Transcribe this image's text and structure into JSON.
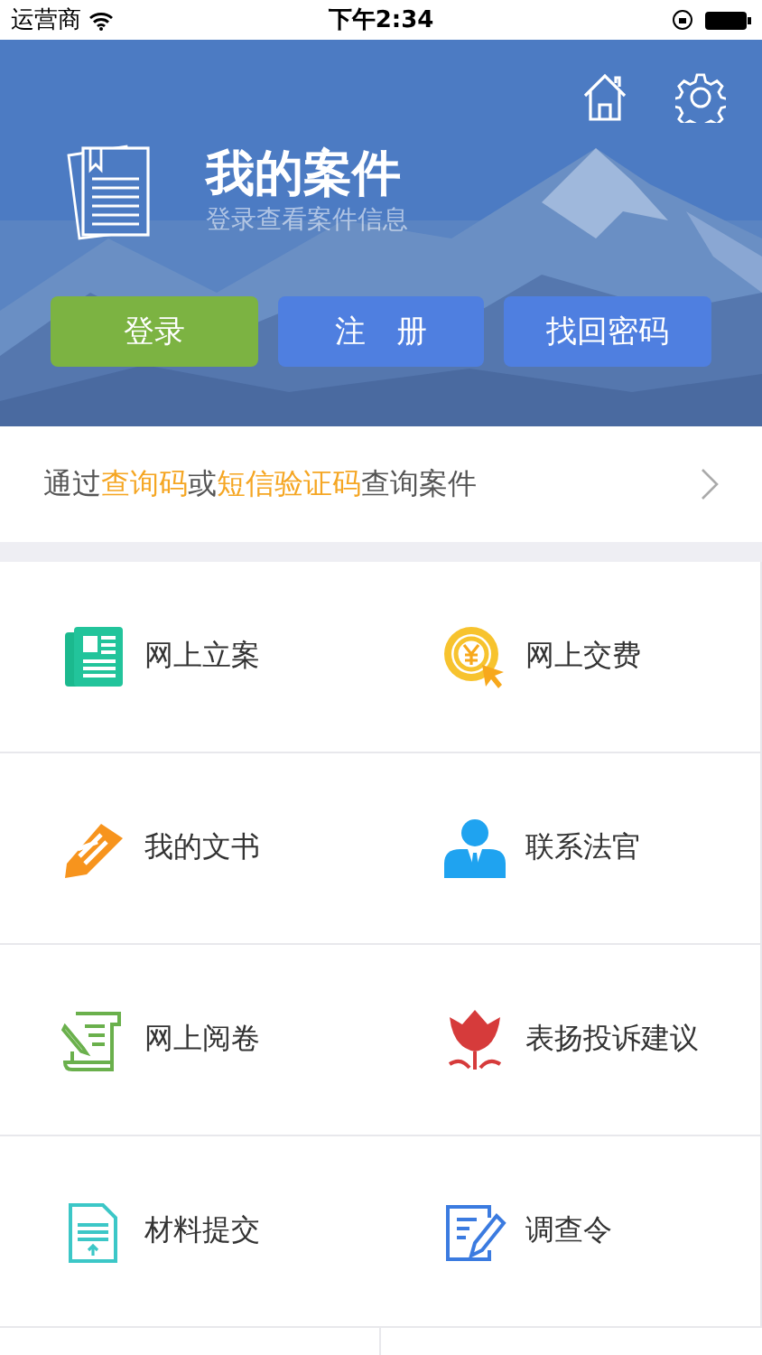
{
  "status_bar": {
    "carrier": "运营商",
    "time": "下午2:34"
  },
  "header": {
    "title": "我的案件",
    "subtitle": "登录查看案件信息",
    "buttons": [
      {
        "label": "登录",
        "color": "#7cb342"
      },
      {
        "label": "注　册",
        "color": "#4f7fe0"
      },
      {
        "label": "找回密码",
        "color": "#4f7fe0"
      }
    ]
  },
  "query": {
    "segments": [
      {
        "text": "通过",
        "highlight": false
      },
      {
        "text": "查询码",
        "highlight": true
      },
      {
        "text": "或",
        "highlight": false
      },
      {
        "text": "短信验证码",
        "highlight": true
      },
      {
        "text": "查询案件",
        "highlight": false
      }
    ]
  },
  "services": [
    {
      "label": "网上立案"
    },
    {
      "label": "网上交费"
    },
    {
      "label": "我的文书"
    },
    {
      "label": "联系法官"
    },
    {
      "label": "网上阅卷"
    },
    {
      "label": "表扬投诉建议"
    },
    {
      "label": "材料提交"
    },
    {
      "label": "调查令"
    }
  ]
}
